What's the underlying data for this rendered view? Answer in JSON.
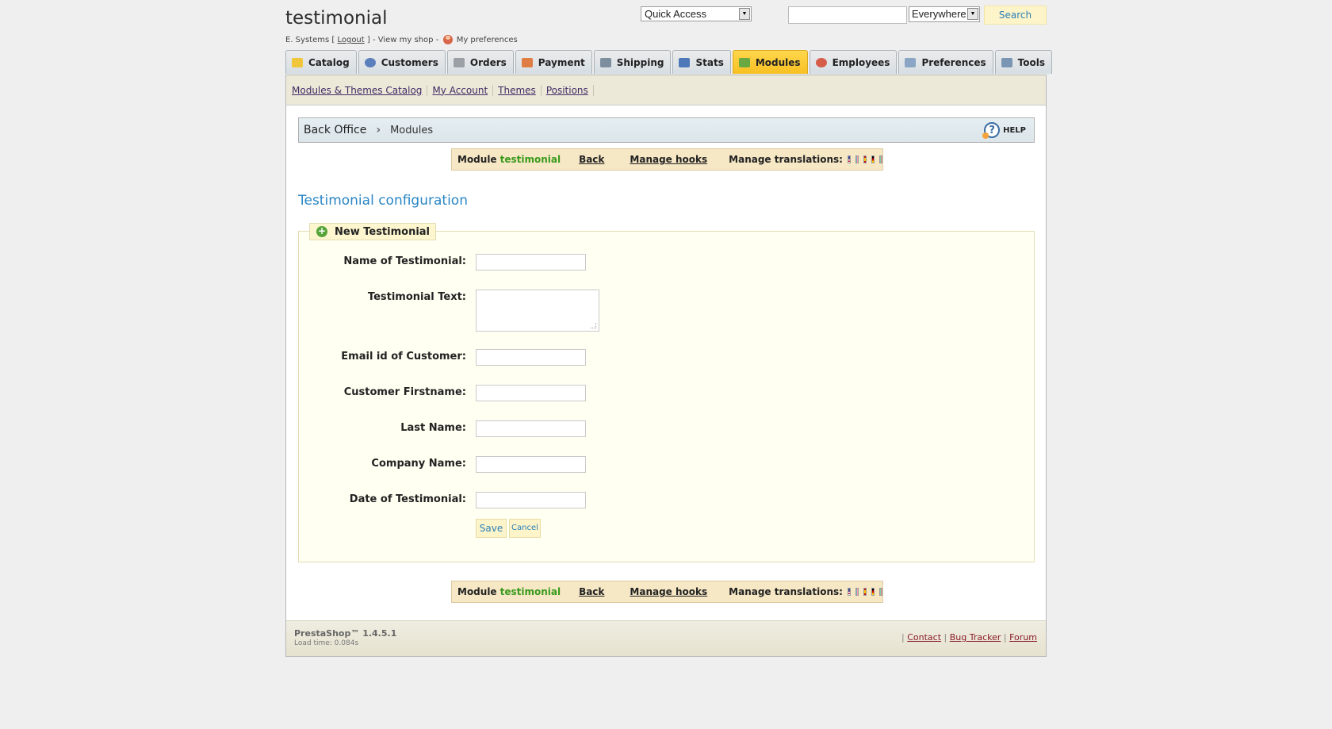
{
  "header": {
    "shop_name": "testimonial",
    "user_prefix": "E. Systems [",
    "logout": "Logout",
    "user_mid": "] - View my shop -",
    "my_preferences": "My preferences",
    "quick_access": "Quick Access",
    "search_scope": "Everywhere",
    "search_button": "Search"
  },
  "tabs": [
    {
      "label": "Catalog",
      "color": "#f0c63c"
    },
    {
      "label": "Customers",
      "color": "#5b7ebd"
    },
    {
      "label": "Orders",
      "color": "#9aa0a6"
    },
    {
      "label": "Payment",
      "color": "#e07d45"
    },
    {
      "label": "Shipping",
      "color": "#7d8e9e"
    },
    {
      "label": "Stats",
      "color": "#4e79b8"
    },
    {
      "label": "Modules",
      "color": "#6aa842"
    },
    {
      "label": "Employees",
      "color": "#d65d4a"
    },
    {
      "label": "Preferences",
      "color": "#8aa6c4"
    },
    {
      "label": "Tools",
      "color": "#7b95b5"
    }
  ],
  "subnav": [
    "Modules & Themes Catalog",
    "My Account",
    "Themes",
    "Positions"
  ],
  "breadcrumb": {
    "root": "Back Office",
    "current": "Modules",
    "help": "HELP"
  },
  "module_bar": {
    "module_label": "Module",
    "module_name": "testimonial",
    "back": "Back",
    "manage_hooks": "Manage hooks",
    "manage_translations": "Manage translations:"
  },
  "config_title": "Testimonial configuration",
  "form": {
    "legend": "New Testimonial",
    "fields": {
      "name": "Name of Testimonial:",
      "text": "Testimonial Text:",
      "email": "Email id of Customer:",
      "firstname": "Customer Firstname:",
      "lastname": "Last Name:",
      "company": "Company Name:",
      "date": "Date of Testimonial:"
    },
    "save": "Save",
    "cancel": "Cancel"
  },
  "footer": {
    "version": "PrestaShop™ 1.4.5.1",
    "load_time": "Load time: 0.084s",
    "contact": "Contact",
    "bug_tracker": "Bug Tracker",
    "forum": "Forum"
  }
}
